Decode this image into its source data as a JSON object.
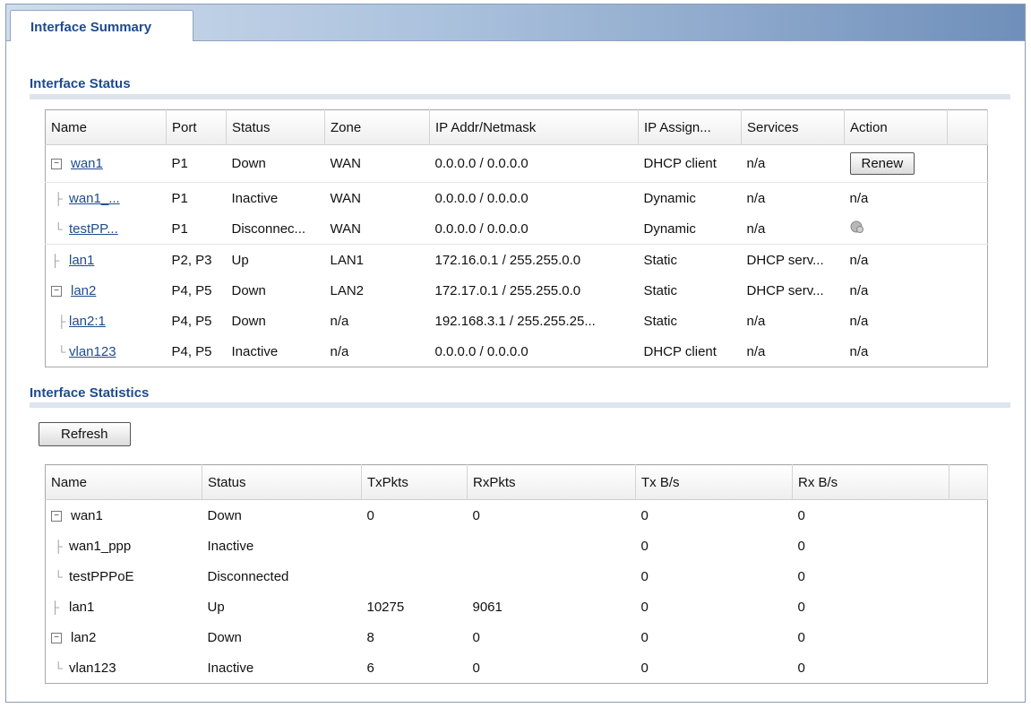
{
  "tab": {
    "label": "Interface Summary"
  },
  "status": {
    "title": "Interface Status",
    "headers": [
      "Name",
      "Port",
      "Status",
      "Zone",
      "IP Addr/Netmask",
      "IP Assign...",
      "Services",
      "Action"
    ],
    "rows": [
      {
        "name": "wan1",
        "port": "P1",
        "status": "Down",
        "zone": "WAN",
        "ip": "0.0.0.0 / 0.0.0.0",
        "assign": "DHCP client",
        "services": "n/a",
        "action": "Renew"
      },
      {
        "name": "wan1_...",
        "port": "P1",
        "status": "Inactive",
        "zone": "WAN",
        "ip": "0.0.0.0 / 0.0.0.0",
        "assign": "Dynamic",
        "services": "n/a",
        "action": "n/a"
      },
      {
        "name": "testPP...",
        "port": "P1",
        "status": "Disconnec...",
        "zone": "WAN",
        "ip": "0.0.0.0 / 0.0.0.0",
        "assign": "Dynamic",
        "services": "n/a",
        "action": ""
      },
      {
        "name": "lan1",
        "port": "P2, P3",
        "status": "Up",
        "zone": "LAN1",
        "ip": "172.16.0.1 / 255.255.0.0",
        "assign": "Static",
        "services": "DHCP serv...",
        "action": "n/a"
      },
      {
        "name": "lan2",
        "port": "P4, P5",
        "status": "Down",
        "zone": "LAN2",
        "ip": "172.17.0.1 / 255.255.0.0",
        "assign": "Static",
        "services": "DHCP serv...",
        "action": "n/a"
      },
      {
        "name": "lan2:1",
        "port": "P4, P5",
        "status": "Down",
        "zone": "n/a",
        "ip": "192.168.3.1 / 255.255.25...",
        "assign": "Static",
        "services": "n/a",
        "action": "n/a"
      },
      {
        "name": "vlan123",
        "port": "P4, P5",
        "status": "Inactive",
        "zone": "n/a",
        "ip": "0.0.0.0 / 0.0.0.0",
        "assign": "DHCP client",
        "services": "n/a",
        "action": "n/a"
      }
    ]
  },
  "stats": {
    "title": "Interface Statistics",
    "refresh_label": "Refresh",
    "headers": [
      "Name",
      "Status",
      "TxPkts",
      "RxPkts",
      "Tx B/s",
      "Rx B/s"
    ],
    "rows": [
      {
        "name": "wan1",
        "status": "Down",
        "tx": "0",
        "rx": "0",
        "txb": "0",
        "rxb": "0"
      },
      {
        "name": "wan1_ppp",
        "status": "Inactive",
        "tx": "",
        "rx": "",
        "txb": "0",
        "rxb": "0"
      },
      {
        "name": "testPPPoE",
        "status": "Disconnected",
        "tx": "",
        "rx": "",
        "txb": "0",
        "rxb": "0"
      },
      {
        "name": "lan1",
        "status": "Up",
        "tx": "10275",
        "rx": "9061",
        "txb": "0",
        "rxb": "0"
      },
      {
        "name": "lan2",
        "status": "Down",
        "tx": "8",
        "rx": "0",
        "txb": "0",
        "rxb": "0"
      },
      {
        "name": "vlan123",
        "status": "Inactive",
        "tx": "6",
        "rx": "0",
        "txb": "0",
        "rxb": "0"
      }
    ]
  }
}
